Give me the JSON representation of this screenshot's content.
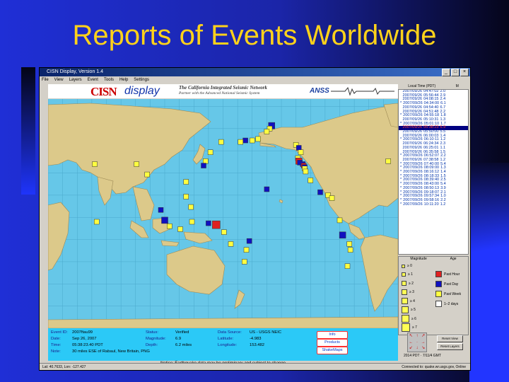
{
  "slide": {
    "title": "Reports of Events Worldwide"
  },
  "window": {
    "title": "CISN Display, Version 1.4",
    "menu": [
      "File",
      "View",
      "Layers",
      "Event",
      "Tools",
      "Help",
      "Settings"
    ]
  },
  "banner": {
    "logo_a": "CISN",
    "logo_b": "display",
    "tagline1": "The California Integrated Seismic Network",
    "tagline2": "Partner with the Advanced National Seismic System",
    "anss": "ANSS"
  },
  "event_list": {
    "headers": [
      "Local Time (PDT)",
      "M"
    ],
    "rows": [
      {
        "date": "2007/09/26",
        "time": "04:47:02",
        "mag": "2.0",
        "star": false
      },
      {
        "date": "2007/09/26",
        "time": "05:56:44",
        "mag": "2.9",
        "star": false
      },
      {
        "date": "2007/09/26",
        "time": "04:08:15",
        "mag": "2.4",
        "star": false
      },
      {
        "date": "2007/09/26",
        "time": "04:34:00",
        "mag": "6.1",
        "star": true
      },
      {
        "date": "2007/09/26",
        "time": "04:54:40",
        "mag": "6.7",
        "star": false
      },
      {
        "date": "2007/09/26",
        "time": "04:51:48",
        "mag": "2.2",
        "star": false
      },
      {
        "date": "2007/09/26",
        "time": "04:55:18",
        "mag": "1.8",
        "star": true
      },
      {
        "date": "2007/09/26",
        "time": "05:10:31",
        "mag": "1.3",
        "star": false
      },
      {
        "date": "2007/09/26",
        "time": "05:01:10",
        "mag": "1.7",
        "star": true
      },
      {
        "date": "2007/09/26",
        "time": "05:38:23",
        "mag": "6.9",
        "star": false,
        "selected": true
      },
      {
        "date": "2007/09/26",
        "time": "05:50:00",
        "mag": "5.5",
        "star": false
      },
      {
        "date": "2007/09/26",
        "time": "06:00:03",
        "mag": "1.4",
        "star": false
      },
      {
        "date": "2007/09/26",
        "time": "06:10:11",
        "mag": "1.2",
        "star": true
      },
      {
        "date": "2007/09/26",
        "time": "06:24:34",
        "mag": "2.3",
        "star": false
      },
      {
        "date": "2007/09/26",
        "time": "06:25:01",
        "mag": "1.1",
        "star": false
      },
      {
        "date": "2007/09/26",
        "time": "06:35:58",
        "mag": "1.5",
        "star": false
      },
      {
        "date": "2007/09/26",
        "time": "06:52:07",
        "mag": "2.2",
        "star": true
      },
      {
        "date": "2007/09/26",
        "time": "07:38:58",
        "mag": "1.2",
        "star": false
      },
      {
        "date": "2007/09/26",
        "time": "07:40:00",
        "mag": "5.4",
        "star": true
      },
      {
        "date": "2007/09/26",
        "time": "08:09:00",
        "mag": "1.3",
        "star": true
      },
      {
        "date": "2007/09/26",
        "time": "08:16:12",
        "mag": "1.4",
        "star": true
      },
      {
        "date": "2007/09/26",
        "time": "08:18:33",
        "mag": "1.5",
        "star": true
      },
      {
        "date": "2007/09/26",
        "time": "08:39:40",
        "mag": "2.5",
        "star": true
      },
      {
        "date": "2007/09/26",
        "time": "08:43:00",
        "mag": "5.4",
        "star": true
      },
      {
        "date": "2007/09/26",
        "time": "08:50:13",
        "mag": "3.9",
        "star": true
      },
      {
        "date": "2007/09/26",
        "time": "09:18:07",
        "mag": "2.1",
        "star": true
      },
      {
        "date": "2007/09/26",
        "time": "09:57:34",
        "mag": "1.0",
        "star": true
      },
      {
        "date": "2007/09/26",
        "time": "09:58:16",
        "mag": "2.2",
        "star": true
      },
      {
        "date": "2007/09/26",
        "time": "10:11:20",
        "mag": "1.2",
        "star": true
      }
    ]
  },
  "legend": {
    "headers": [
      "Magnitude",
      "Age"
    ],
    "mags": [
      "≥ 0",
      "≥ 1",
      "≥ 2",
      "≥ 3",
      "≥ 4",
      "≥ 5",
      "≥ 6",
      "≥ 7"
    ],
    "ages": [
      {
        "label": "Past Hour",
        "color": "#e02020"
      },
      {
        "label": "Past Day",
        "color": "#1010c0"
      },
      {
        "label": "Past Week",
        "color": "#ffff40"
      },
      {
        "label": "1–2 days",
        "color": "#ffffff"
      }
    ]
  },
  "controls": {
    "reset_view": "Reset View",
    "reset_layers": "Reset Layers",
    "clock": "2014 PDT · 7/11/4 GMT"
  },
  "event_info": {
    "event_id_label": "Event ID:",
    "event_id": "2007ftau99",
    "date_label": "Date:",
    "date": "Sep 26, 2007",
    "time_label": "Time:",
    "time": "05:38:23.40 PDT",
    "note_label": "Note:",
    "note": "30 miles ESE of Rabaul, New Britain, PNG",
    "status_label": "Status:",
    "status": "Verified",
    "mag_label": "Magnitude:",
    "mag": "6.9",
    "depth_label": "Depth:",
    "depth": "6.2 miles",
    "source_label": "Data Source:",
    "source": "US - USGS NEIC",
    "lat_label": "Latitude:",
    "lat": "-4.983",
    "lon_label": "Longitude:",
    "lon": "153.482",
    "buttons": [
      "Info",
      "Products",
      "ShakeMaps"
    ]
  },
  "notice": "Notice:  Earthquake data may be preliminary and subject to change",
  "statusbar": {
    "left": "Lat: 40.7633, Lon: -127.427",
    "right": "Connected to: quake.wr.usgs.gov, Online"
  },
  "map_events": [
    {
      "lat": 62,
      "lon": -150,
      "size": 2,
      "color": "#1010c0"
    },
    {
      "lat": 60,
      "lon": -152,
      "size": 1,
      "color": "#ffff40"
    },
    {
      "lat": 58,
      "lon": -155,
      "size": 1,
      "color": "#ffff40"
    },
    {
      "lat": 53,
      "lon": -164,
      "size": 1,
      "color": "#ffff40"
    },
    {
      "lat": 52,
      "lon": -170,
      "size": 1,
      "color": "#ffff40"
    },
    {
      "lat": 52,
      "lon": -177,
      "size": 1,
      "color": "#1010c0"
    },
    {
      "lat": 51,
      "lon": 178,
      "size": 1,
      "color": "#ffff40"
    },
    {
      "lat": 49,
      "lon": -125,
      "size": 1,
      "color": "#ffff40"
    },
    {
      "lat": 47,
      "lon": -122,
      "size": 1,
      "color": "#1010c0"
    },
    {
      "lat": 44,
      "lon": -120,
      "size": 1,
      "color": "#ffff40"
    },
    {
      "lat": 40,
      "lon": -123,
      "size": 1,
      "color": "#ffff40"
    },
    {
      "lat": 38,
      "lon": -122,
      "size": 2,
      "color": "#e02020"
    },
    {
      "lat": 37,
      "lon": -121,
      "size": 1,
      "color": "#1010c0"
    },
    {
      "lat": 36,
      "lon": -118,
      "size": 1,
      "color": "#1010c0"
    },
    {
      "lat": 35,
      "lon": -117,
      "size": 1,
      "color": "#e02020"
    },
    {
      "lat": 34,
      "lon": -116,
      "size": 1,
      "color": "#1010c0"
    },
    {
      "lat": 33,
      "lon": -116,
      "size": 1,
      "color": "#ffff40"
    },
    {
      "lat": 19,
      "lon": -155,
      "size": 1,
      "color": "#1010c0"
    },
    {
      "lat": 31,
      "lon": -115,
      "size": 1,
      "color": "#ffff40"
    },
    {
      "lat": 25,
      "lon": -110,
      "size": 1,
      "color": "#ffff40"
    },
    {
      "lat": 17,
      "lon": -100,
      "size": 1,
      "color": "#1010c0"
    },
    {
      "lat": 15,
      "lon": -92,
      "size": 1,
      "color": "#ffff40"
    },
    {
      "lat": 13,
      "lon": -88,
      "size": 1,
      "color": "#ffff40"
    },
    {
      "lat": -2,
      "lon": -80,
      "size": 1,
      "color": "#ffff40"
    },
    {
      "lat": -12,
      "lon": -77,
      "size": 2,
      "color": "#1010c0"
    },
    {
      "lat": -18,
      "lon": -70,
      "size": 1,
      "color": "#ffff40"
    },
    {
      "lat": -22,
      "lon": -69,
      "size": 1,
      "color": "#ffff40"
    },
    {
      "lat": -33,
      "lon": -72,
      "size": 1,
      "color": "#ffff40"
    },
    {
      "lat": 51,
      "lon": 158,
      "size": 1,
      "color": "#ffff40"
    },
    {
      "lat": 44,
      "lon": 147,
      "size": 1,
      "color": "#ffff40"
    },
    {
      "lat": 38,
      "lon": 142,
      "size": 1,
      "color": "#ffff40"
    },
    {
      "lat": 35,
      "lon": 140,
      "size": 1,
      "color": "#1010c0"
    },
    {
      "lat": 24,
      "lon": 122,
      "size": 1,
      "color": "#ffff40"
    },
    {
      "lat": 14,
      "lon": 122,
      "size": 1,
      "color": "#ffff40"
    },
    {
      "lat": 7,
      "lon": 127,
      "size": 1,
      "color": "#ffff40"
    },
    {
      "lat": 5,
      "lon": 96,
      "size": 1,
      "color": "#1010c0"
    },
    {
      "lat": -2,
      "lon": 100,
      "size": 2,
      "color": "#1010c0"
    },
    {
      "lat": -6,
      "lon": 105,
      "size": 1,
      "color": "#ffff40"
    },
    {
      "lat": -8,
      "lon": 116,
      "size": 1,
      "color": "#ffff40"
    },
    {
      "lat": -3,
      "lon": 128,
      "size": 1,
      "color": "#ffff40"
    },
    {
      "lat": -5,
      "lon": 153,
      "size": 3,
      "color": "#e02020"
    },
    {
      "lat": -4,
      "lon": 145,
      "size": 1,
      "color": "#1010c0"
    },
    {
      "lat": -10,
      "lon": 161,
      "size": 1,
      "color": "#ffff40"
    },
    {
      "lat": -18,
      "lon": 168,
      "size": 1,
      "color": "#ffff40"
    },
    {
      "lat": -22,
      "lon": -176,
      "size": 1,
      "color": "#ffff40"
    },
    {
      "lat": -30,
      "lon": -178,
      "size": 1,
      "color": "#ffff40"
    },
    {
      "lat": -16,
      "lon": -173,
      "size": 1,
      "color": "#1010c0"
    },
    {
      "lat": 36,
      "lon": 71,
      "size": 1,
      "color": "#ffff40"
    },
    {
      "lat": 29,
      "lon": 82,
      "size": 1,
      "color": "#ffff40"
    },
    {
      "lat": 38,
      "lon": -30,
      "size": 1,
      "color": "#ffff40"
    },
    {
      "lat": 36,
      "lon": 28,
      "size": 1,
      "color": "#ffff40"
    },
    {
      "lat": -3,
      "lon": 30,
      "size": 1,
      "color": "#ffff40"
    }
  ]
}
